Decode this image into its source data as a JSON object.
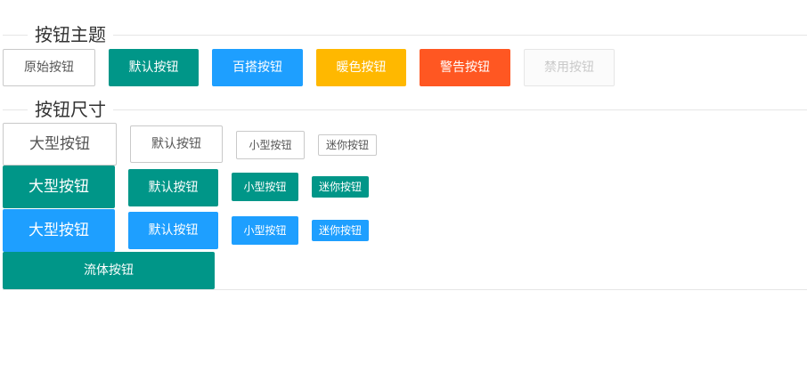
{
  "sections": {
    "theme_title": "按钮主题",
    "size_title": "按钮尺寸"
  },
  "theme_buttons": {
    "primary": "原始按钮",
    "default": "默认按钮",
    "normal": "百搭按钮",
    "warm": "暖色按钮",
    "danger": "警告按钮",
    "disabled": "禁用按钮"
  },
  "size_buttons": {
    "large": "大型按钮",
    "default": "默认按钮",
    "small": "小型按钮",
    "mini": "迷你按钮",
    "fluid": "流体按钮"
  },
  "colors": {
    "default": "#009688",
    "normal": "#1E9FFF",
    "warm": "#FFB800",
    "danger": "#FF5722",
    "border": "#C9C9C9"
  }
}
